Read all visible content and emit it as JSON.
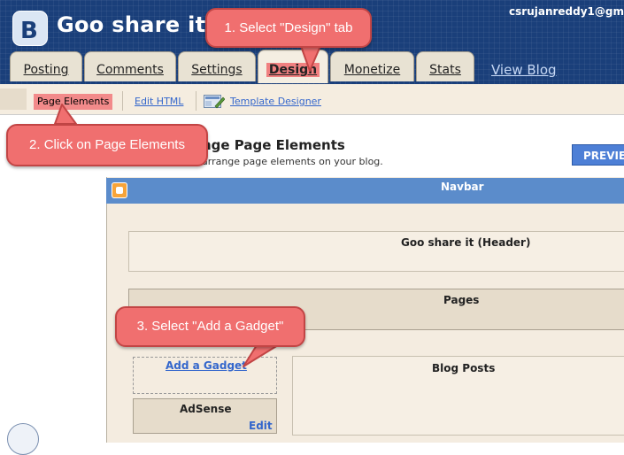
{
  "header": {
    "logo_letter": "B",
    "blog_title": "Goo share it",
    "user_email": "csrujanreddy1@gm"
  },
  "tabs": [
    {
      "label": "Posting",
      "active": false
    },
    {
      "label": "Comments",
      "active": false
    },
    {
      "label": "Settings",
      "active": false
    },
    {
      "label": "Design",
      "active": true
    },
    {
      "label": "Monetize",
      "active": false
    },
    {
      "label": "Stats",
      "active": false
    }
  ],
  "view_blog_label": "View Blog",
  "subnav": {
    "page_elements": "Page Elements",
    "edit_html": "Edit HTML",
    "template_designer": "Template Designer"
  },
  "page": {
    "heading": "nge Page Elements",
    "subheading": "arrange page elements on your blog.",
    "preview_button": "PREVIE"
  },
  "layout": {
    "navbar": "Navbar",
    "header_widget": "Goo share it (Header)",
    "pages_widget": "Pages",
    "add_gadget": "Add a Gadget",
    "blog_posts": "Blog Posts",
    "adsense": "AdSense",
    "adsense_edit": "Edit"
  },
  "callouts": {
    "step1": "1. Select \"Design\" tab",
    "step2": "2. Click on Page Elements",
    "step3": "3. Select \"Add a Gadget\""
  },
  "colors": {
    "header_bg": "#1a3f7a",
    "callout": "#f06f6f",
    "link": "#3366cc",
    "navbar": "#5b8ccb"
  }
}
